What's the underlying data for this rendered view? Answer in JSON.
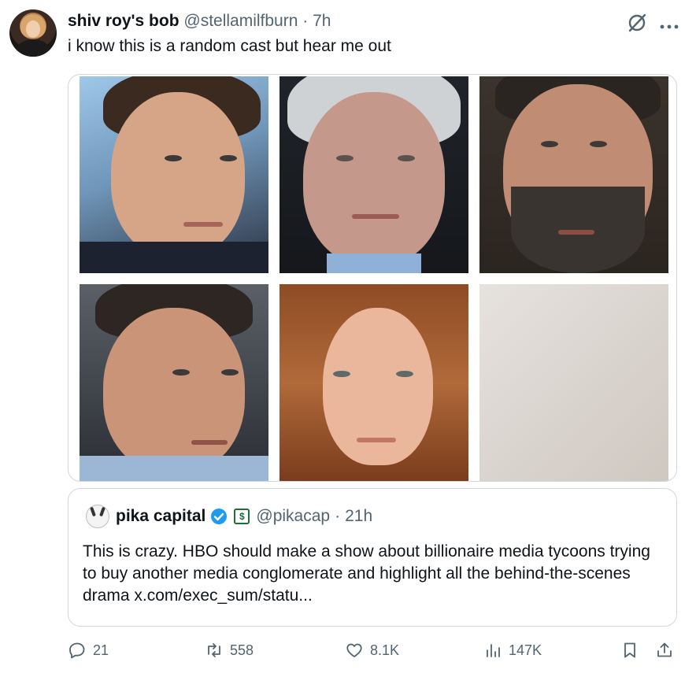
{
  "post": {
    "author_name": "shiv roy's bob",
    "author_handle": "@stellamilfburn",
    "separator": "·",
    "time": "7h",
    "text": "i know this is a random cast but hear me out"
  },
  "icons": {
    "grok": "grok-icon",
    "more": "more-icon",
    "reply": "reply-icon",
    "retweet": "retweet-icon",
    "like": "heart-icon",
    "views": "views-icon",
    "bookmark": "bookmark-icon",
    "share": "share-icon"
  },
  "quoted": {
    "name": "pika capital",
    "handle": "@pikacap",
    "separator": "·",
    "time": "21h",
    "text": "This is crazy. HBO should make a show about billionaire media tycoons trying to buy another media conglomerate and highlight all the behind-the-scenes drama x.com/exec_sum/statu..."
  },
  "metrics": {
    "replies": "21",
    "reposts": "558",
    "likes": "8.1K",
    "views": "147K"
  },
  "colors": {
    "text_primary": "#0f1419",
    "text_secondary": "#536471",
    "border": "#cfd9de",
    "verified_blue": "#1d9bf0"
  }
}
